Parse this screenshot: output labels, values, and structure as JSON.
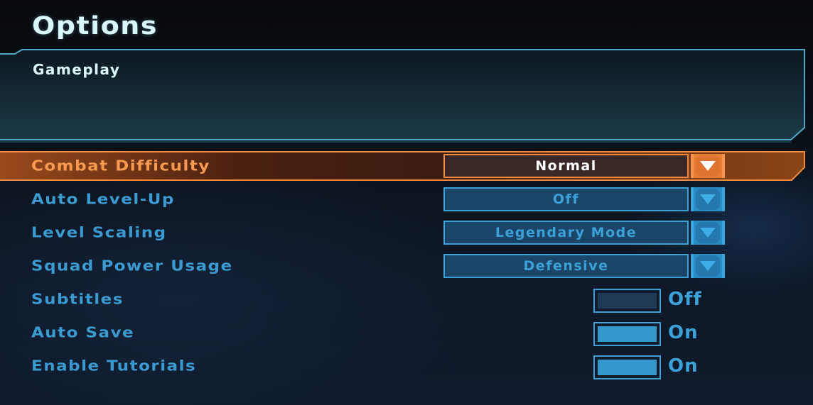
{
  "header": {
    "title": "Options"
  },
  "panel": {
    "title": "Gameplay"
  },
  "colors": {
    "accent_blue": "#3b9ad0",
    "accent_orange": "#f79a4f",
    "title_text": "#d9f6fa",
    "selected_value_text": "#ffffff"
  },
  "settings": [
    {
      "label": "Combat Difficulty",
      "type": "dropdown",
      "value": "Normal",
      "selected": true,
      "icon": "chevron-down-icon"
    },
    {
      "label": "Auto Level-Up",
      "type": "dropdown",
      "value": "Off",
      "selected": false,
      "icon": "chevron-down-icon"
    },
    {
      "label": "Level Scaling",
      "type": "dropdown",
      "value": "Legendary Mode",
      "selected": false,
      "icon": "chevron-down-icon"
    },
    {
      "label": "Squad Power Usage",
      "type": "dropdown",
      "value": "Defensive",
      "selected": false,
      "icon": "chevron-down-icon"
    },
    {
      "label": "Subtitles",
      "type": "toggle",
      "value": "Off",
      "on": false
    },
    {
      "label": "Auto Save",
      "type": "toggle",
      "value": "On",
      "on": true
    },
    {
      "label": "Enable Tutorials",
      "type": "toggle",
      "value": "On",
      "on": true
    }
  ]
}
